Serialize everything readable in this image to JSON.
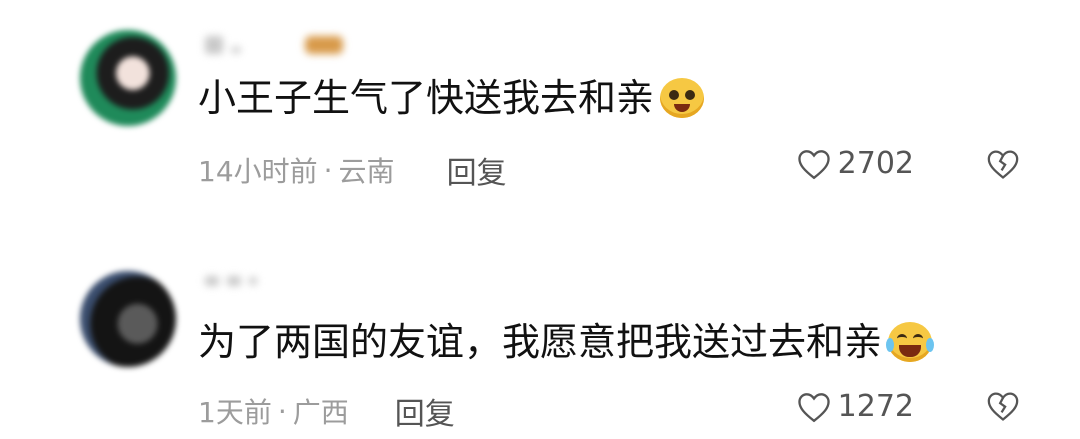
{
  "comments": [
    {
      "text": "小王子生气了快送我去和亲",
      "emoji": "pleading-face-icon",
      "time": "14小时前",
      "location": "云南",
      "reply_label": "回复",
      "likes": "2702"
    },
    {
      "text": "为了两国的友谊，我愿意把我送过去和亲",
      "emoji": "laughing-crying-face-icon",
      "time": "1天前",
      "location": "广西",
      "reply_label": "回复",
      "likes": "1272"
    }
  ],
  "separator": "·"
}
